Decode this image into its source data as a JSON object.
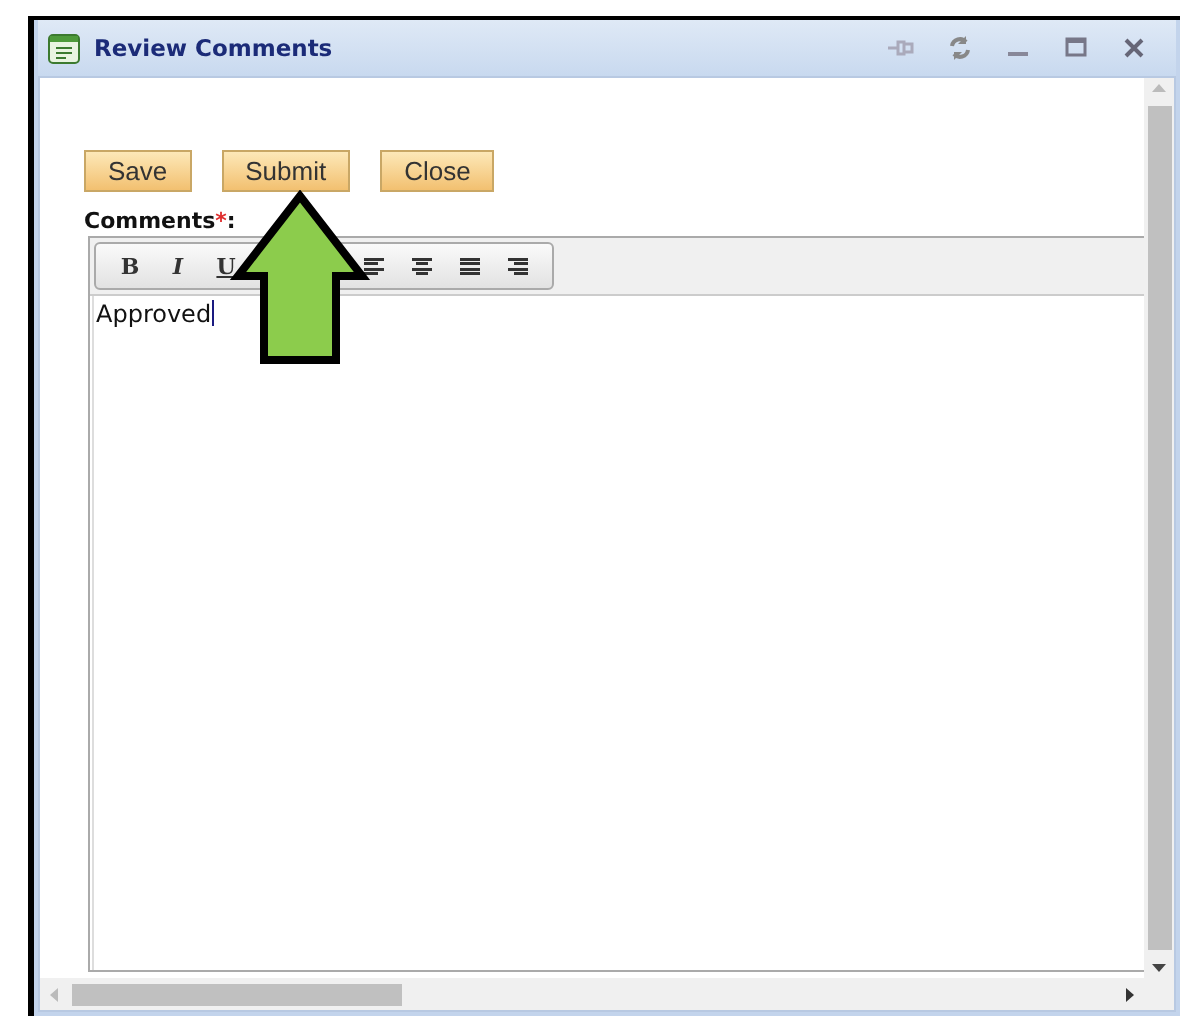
{
  "window": {
    "title": "Review Comments",
    "controls": [
      {
        "kind": "pin"
      },
      {
        "kind": "refresh"
      },
      {
        "kind": "minimize"
      },
      {
        "kind": "maximize"
      },
      {
        "kind": "close"
      }
    ]
  },
  "buttons": [
    {
      "label": "Save"
    },
    {
      "label": "Submit"
    },
    {
      "label": "Close"
    }
  ],
  "field": {
    "label": "Comments",
    "required_mark": "*",
    "suffix": ":"
  },
  "toolbar": [
    {
      "kind": "bold",
      "label": "B"
    },
    {
      "kind": "italic",
      "label": "I"
    },
    {
      "kind": "underline",
      "label": "U"
    },
    {
      "kind": "align-left"
    },
    {
      "kind": "align-center"
    },
    {
      "kind": "align-justify"
    },
    {
      "kind": "align-right"
    }
  ],
  "editor": {
    "value": "Approved"
  },
  "annotation": {
    "kind": "arrow"
  }
}
